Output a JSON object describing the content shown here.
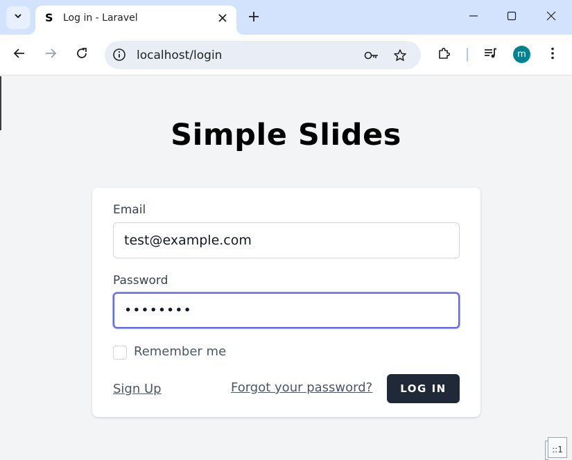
{
  "browser": {
    "tab": {
      "favicon": "S",
      "title": "Log in - Laravel"
    },
    "address": {
      "url": "localhost/login"
    },
    "profile_initial": "m"
  },
  "icons": {
    "tab_list": "chevron-down-icon",
    "tab_close": "close-icon",
    "new_tab": "plus-icon",
    "minimize": "minimize-icon",
    "maximize": "maximize-icon",
    "close_window": "close-icon",
    "back": "arrow-left-icon",
    "forward": "arrow-right-icon",
    "reload": "reload-icon",
    "site_info": "info-icon",
    "password_key": "key-icon",
    "bookmark": "star-icon",
    "extensions": "puzzle-icon",
    "media": "media-control-icon",
    "menu": "kebab-menu-icon"
  },
  "page": {
    "app_title": "Simple Slides",
    "form": {
      "email_label": "Email",
      "email_value": "test@example.com",
      "password_label": "Password",
      "password_value": "••••••••",
      "remember_label": "Remember me",
      "remember_checked": false,
      "signup_link": "Sign Up",
      "forgot_link": "Forgot your password?",
      "login_button": "LOG IN"
    },
    "corner_indicator": "::1"
  },
  "colors": {
    "focus_ring": "#6366f1",
    "button_bg": "#1f2937",
    "page_bg": "#f3f4f6",
    "tabstrip_bg": "#d3e3fd",
    "avatar_bg": "#00838f"
  }
}
